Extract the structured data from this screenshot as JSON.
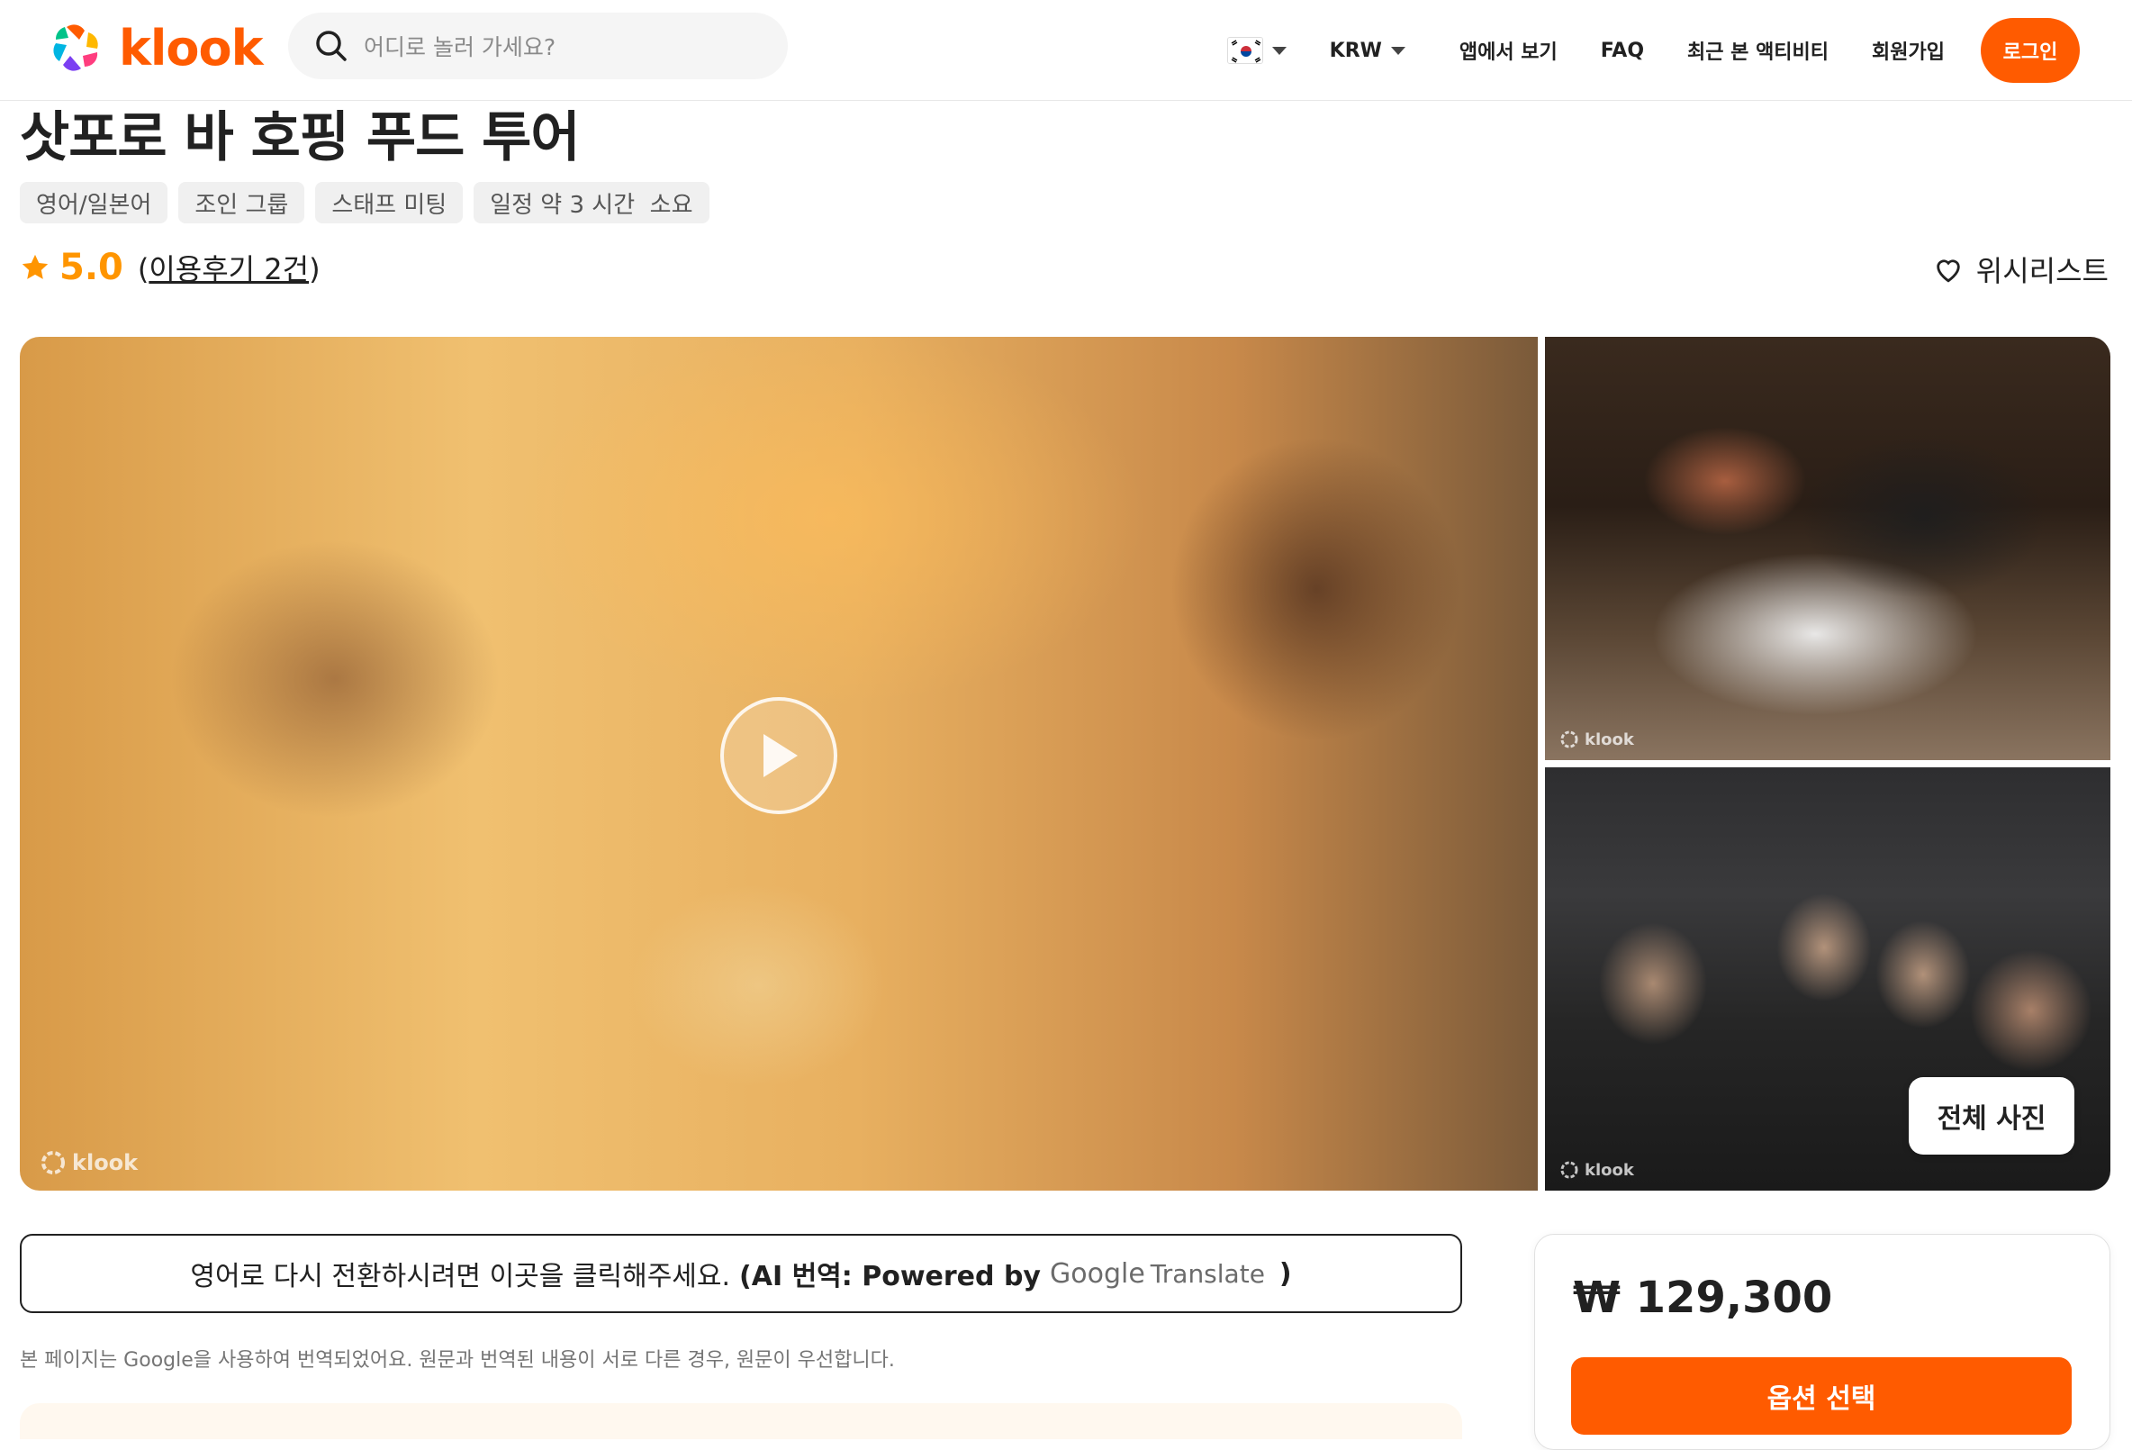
{
  "header": {
    "brand": "klook",
    "search_placeholder": "어디로 놀러 가세요?",
    "nav": {
      "currency": "KRW",
      "app_link": "앱에서 보기",
      "faq": "FAQ",
      "recent": "최근 본 액티비티",
      "signup": "회원가입",
      "login": "로그인"
    }
  },
  "activity": {
    "title": "삿포로 바 호핑 푸드 투어",
    "tags": [
      "영어/일본어",
      "조인 그룹",
      "스태프 미팅",
      "일정 약 3 시간  소요"
    ],
    "rating": "5.0",
    "reviews_open": "(",
    "reviews_label": "이용후기 2건",
    "reviews_close": ")",
    "wishlist": "위시리스트"
  },
  "gallery": {
    "watermark": "klook",
    "all_photos": "전체 사진"
  },
  "translation": {
    "message": "영어로 다시 전환하시려면 이곳을 클릭해주세요.",
    "ai_prefix": "(AI 번역: Powered by",
    "google": "Google",
    "translate": "Translate",
    "close_paren": ")",
    "disclaimer": "본 페이지는 Google을 사용하여 번역되었어요. 원문과 번역된 내용이 서로 다른 경우, 원문이 우선합니다."
  },
  "booking": {
    "price": "₩ 129,300",
    "select_option": "옵션 선택"
  },
  "colors": {
    "brand": "#ff5b00",
    "rating": "#ff9500"
  }
}
